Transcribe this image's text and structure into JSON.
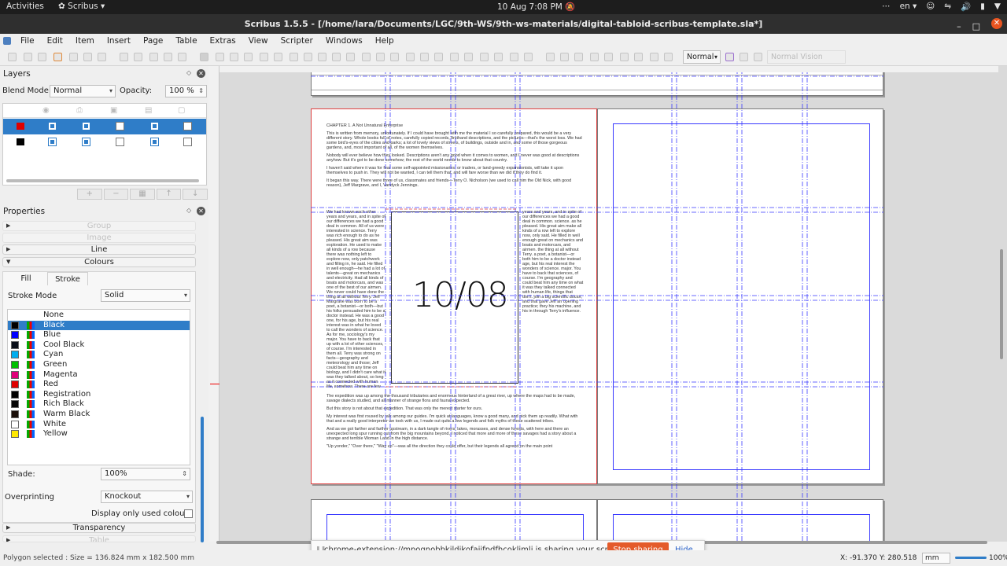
{
  "gnome": {
    "activities": "Activities",
    "app_menu": "Scribus",
    "clock": "10 Aug  7:08 PM",
    "lang": "en"
  },
  "window": {
    "title": "Scribus 1.5.5 - [/home/lara/Documents/LGC/9th-WS/9th-ws-materials/digital-tabloid-scribus-template.sla*]"
  },
  "menu": [
    "File",
    "Edit",
    "Item",
    "Insert",
    "Page",
    "Table",
    "Extras",
    "View",
    "Scripter",
    "Windows",
    "Help"
  ],
  "toolbar": {
    "view_mode": "Normal",
    "vision": "Normal Vision"
  },
  "layers": {
    "title": "Layers",
    "blend_label": "Blend Mode:",
    "blend_value": "Normal",
    "opacity_label": "Opacity:",
    "opacity_value": "100 %",
    "rows": [
      {
        "swatch": "#e00000",
        "selected": true,
        "cols": [
          true,
          true,
          false,
          true,
          false
        ]
      },
      {
        "swatch": "#000000",
        "selected": false,
        "cols": [
          true,
          true,
          false,
          true,
          false
        ]
      }
    ]
  },
  "properties": {
    "title": "Properties",
    "sections": {
      "group": "Group",
      "image": "Image",
      "line": "Line",
      "colours": "Colours",
      "transparency": "Transparency",
      "table": "Table"
    },
    "tabs": {
      "fill": "Fill",
      "stroke": "Stroke"
    },
    "stroke_mode_label": "Stroke Mode",
    "stroke_mode_value": "Solid",
    "colours": [
      {
        "name": "None",
        "color": ""
      },
      {
        "name": "Black",
        "color": "#000000",
        "selected": true
      },
      {
        "name": "Blue",
        "color": "#0000ff"
      },
      {
        "name": "Cool Black",
        "color": "#0a0f1a"
      },
      {
        "name": "Cyan",
        "color": "#00aeef"
      },
      {
        "name": "Green",
        "color": "#00c000"
      },
      {
        "name": "Magenta",
        "color": "#e0007a"
      },
      {
        "name": "Red",
        "color": "#e00000"
      },
      {
        "name": "Registration",
        "color": "#000000"
      },
      {
        "name": "Rich Black",
        "color": "#050505"
      },
      {
        "name": "Warm Black",
        "color": "#1a0f0a"
      },
      {
        "name": "White",
        "color": "#ffffff"
      },
      {
        "name": "Yellow",
        "color": "#ffe800"
      }
    ],
    "shade_label": "Shade:",
    "shade_value": "100%",
    "overprint_label": "Overprinting",
    "overprint_value": "Knockout",
    "display_used_label": "Display only used colours"
  },
  "document": {
    "chapter": "CHAPTER 1. A Not Unnatural Enterprise",
    "para1": "This is written from memory, unfortunately. If I could have brought with me the material I so carefully prepared, this would be a very different story. Whole books full of notes, carefully copied records, firsthand descriptions, and the pictures—that's the worst loss. We had some bird's-eyes of the cities and parks; a lot of lovely views of streets, of buildings, outside and in, and some of those gorgeous gardens, and, most important of all, of the women themselves.",
    "para2": "Nobody will ever believe how they looked. Descriptions aren't any good when it comes to women, and I never was good at descriptions anyhow. But it's got to be done somehow; the rest of the world needs to know about that country.",
    "para3": "I haven't said where it was for fear some self-appointed missionaries, or traders, or land-greedy expansionists, will take it upon themselves to push in. They will not be wanted, I can tell them that, and will fare worse than we did if they do find it.",
    "para4": "It began this way. There were three of us, classmates and friends—Terry O. Nicholson (we used to call him the Old Nick, with good reason), Jeff Margrave, and I, Vandyck Jennings.",
    "col_left": "We had known each other years and years, and in spite of our differences we had a good deal in common. All of us were interested in science. Terry was rich enough to do as he pleased. His great aim was exploration. He used to make all kinds of a row because there was nothing left to explore now, only patchwork and filling in, he said. He filled in well enough—he had a lot of talents—great on mechanics and electricity. Had all kinds of boats and motorcars, and was one of the best of our airmen. We never could have done the thing at all without Terry. Jeff Margrave was born to be a poet, a botanist—or both—but his folks persuaded him to be a doctor instead. He was a good one, for his age, but his real interest was in what he loved to call the wonders of science. As for me, sociology's my major. You have to back that up with a lot of other sciences, of course. I'm interested in them all. Terry was strong on facts—geography and meteorology and those; Jeff could beat him any time on biology, and I didn't care what it was they talked about, so long as it connected with human life, somehow. There are few things that don't. We three had a chance to join a big scientific expedition. They needed a doctor, and that gave Jeff an excuse for dropping his just opening practice; they needed Terry's experience, his machine, and his money; and as for me, I got in through Terry's influence.",
    "col_right": "years and years, and in spite of our differences we had a good deal in common. science. as he pleased. His great aim make all kinds of a row left to explore now, only said. He filled in well enough great on mechanics and boats and motorcars, and airmen. the thing at all without Terry. a poet, a botanist—or both him to be a doctor instead age, but his real interest the wonders of science. major. You have to back that sciences, of course. I'm geography and could beat him any time on what it was they talked connected with human life, things that don't. join a big scientific doctor, and that gave Jeff an opening practice; they his machine, and his in through Terry's influence.",
    "para5": "The expedition was up among the thousand tributaries and enormous hinterland of a great river, up where the maps had to be made, savage dialects studied, and all manner of strange flora and fauna expected.",
    "para6": "But this story is not about that expedition. That was only the merest starter for ours.",
    "para7": "My interest was first roused by talk among our guides. I'm quick at languages, know a good many, and pick them up readily. What with that and a really good interpreter we took with us, I made out quite a few legends and folk myths of these scattered tribes.",
    "para8": "And as we got farther and farther upstream, in a dark tangle of rivers, lakes, morasses, and dense forests, with here and there an unexpected long spur running out from the big mountains beyond, I noticed that more and more of these savages had a story about a strange and terrible Woman Land in the high distance.",
    "para9": "\"Up yonder,\" \"Over there,\" \"Way up\"—was all the direction they could offer, but their legends all agreed on the main point",
    "date": "10/08"
  },
  "share": {
    "message": "chrome-extension://mpognobbkildjkofajifpdfhcoklimli is sharing your screen.",
    "stop": "Stop sharing",
    "hide": "Hide"
  },
  "status": {
    "text": "Polygon selected : Size = 136.824 mm x 182.500 mm",
    "x": "X: -91.370",
    "y": "Y: 280.518",
    "unit": "mm",
    "zoom": "100%"
  },
  "colors": {
    "accent": "#2f7dc8",
    "guide_blue": "#3a3aff",
    "bleed_red": "#e04040",
    "share_button": "#e45b2b"
  }
}
